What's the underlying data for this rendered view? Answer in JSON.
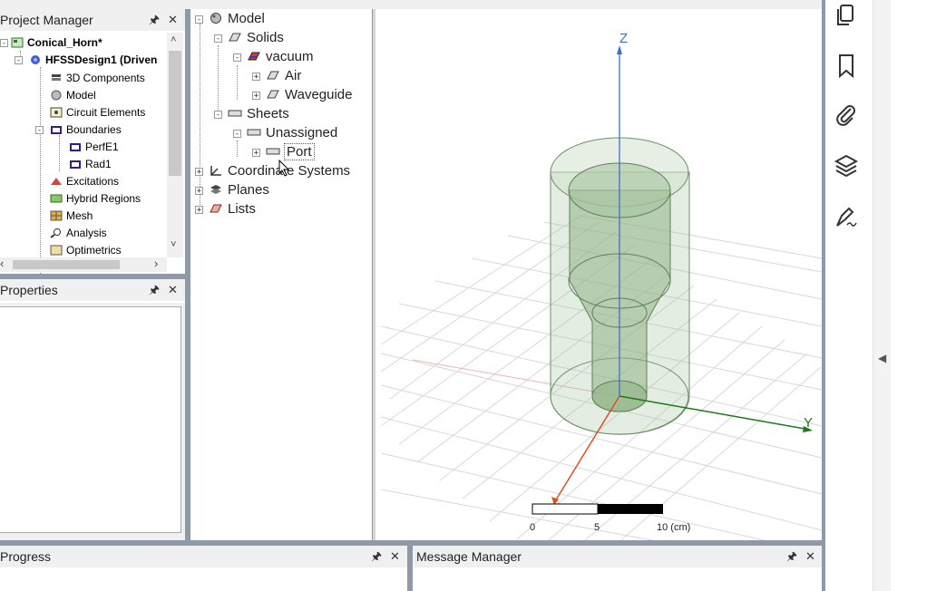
{
  "project_manager": {
    "title": "Project Manager",
    "tree": [
      {
        "label": "Conical_Horn*",
        "bold": true,
        "icon": "project-icon"
      },
      {
        "label": "HFSSDesign1 (Driven",
        "bold": true,
        "icon": "hfss-design-icon"
      },
      {
        "label": "3D Components",
        "icon": "components-icon"
      },
      {
        "label": "Model",
        "icon": "model-icon"
      },
      {
        "label": "Circuit Elements",
        "icon": "circuit-icon"
      },
      {
        "label": "Boundaries",
        "icon": "boundary-icon"
      },
      {
        "label": "PerfE1",
        "icon": "boundary-icon"
      },
      {
        "label": "Rad1",
        "icon": "boundary-icon"
      },
      {
        "label": "Excitations",
        "icon": "excitation-icon"
      },
      {
        "label": "Hybrid Regions",
        "icon": "hybrid-icon"
      },
      {
        "label": "Mesh",
        "icon": "mesh-icon"
      },
      {
        "label": "Analysis",
        "icon": "analysis-icon"
      },
      {
        "label": "Optimetrics",
        "icon": "optimetrics-icon"
      }
    ]
  },
  "properties": {
    "title": "Properties"
  },
  "model_tree": {
    "items": [
      {
        "label": "Model",
        "icon": "model-icon"
      },
      {
        "label": "Solids",
        "icon": "solid-icon"
      },
      {
        "label": "vacuum",
        "icon": "material-icon"
      },
      {
        "label": "Air",
        "icon": "solid-icon"
      },
      {
        "label": "Waveguide",
        "icon": "solid-icon"
      },
      {
        "label": "Sheets",
        "icon": "sheet-icon"
      },
      {
        "label": "Unassigned",
        "icon": "sheet-icon"
      },
      {
        "label": "Port",
        "icon": "sheet-icon"
      },
      {
        "label": "Coordinate Systems",
        "icon": "coordinate-icon"
      },
      {
        "label": "Planes",
        "icon": "planes-icon"
      },
      {
        "label": "Lists",
        "icon": "lists-icon"
      }
    ]
  },
  "viewport": {
    "axis_z": "Z",
    "axis_y": "Y",
    "scale_ticks": [
      "0",
      "5",
      "10 (cm)"
    ],
    "colors": {
      "z_axis": "#3a6fd0",
      "y_axis": "#1a7a1a",
      "x_axis": "#e05020",
      "solid_fill": "#9fbf98"
    }
  },
  "progress": {
    "title": "Progress"
  },
  "message_manager": {
    "title": "Message Manager"
  },
  "right_sidebar": {
    "icons": [
      "pages-icon",
      "bookmark-icon",
      "attachment-icon",
      "layers-icon",
      "signature-icon"
    ]
  }
}
